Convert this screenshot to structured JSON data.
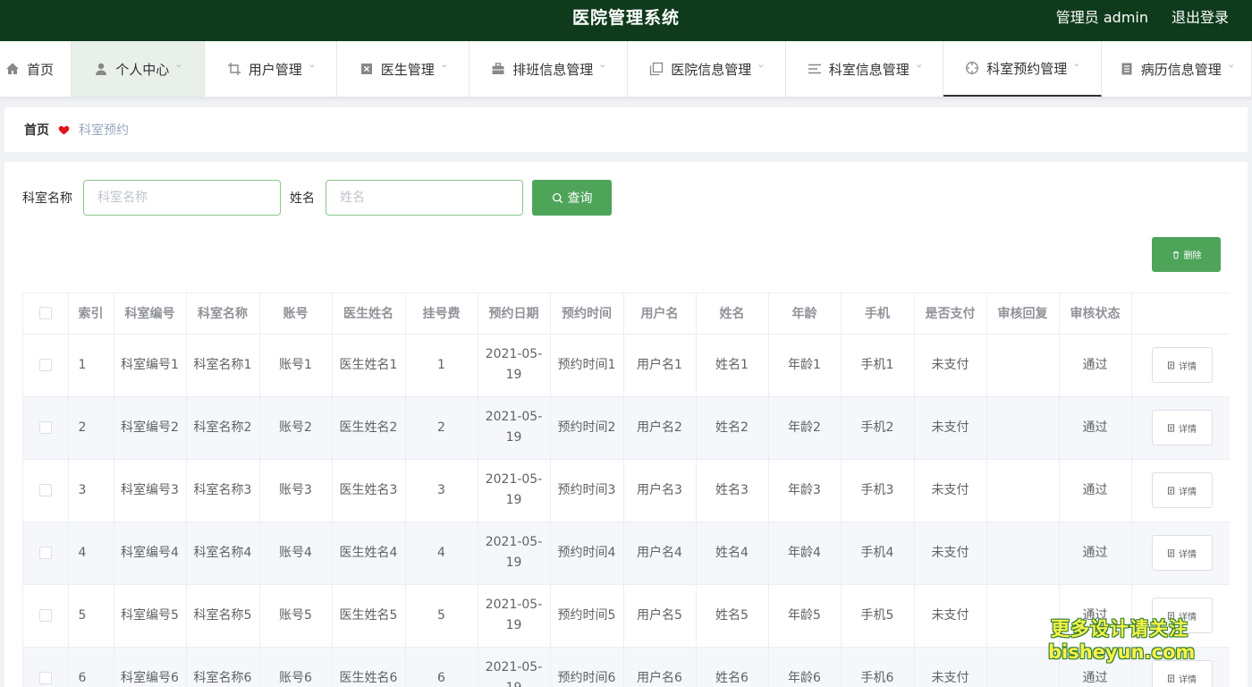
{
  "header": {
    "title": "医院管理系统",
    "user_label": "管理员 admin",
    "logout_label": "退出登录"
  },
  "nav": [
    {
      "key": "home",
      "label": "首页",
      "icon": "home-icon",
      "dropdown": false,
      "highlighted": false,
      "active": false
    },
    {
      "key": "personal-center",
      "label": "个人中心",
      "icon": "user-icon",
      "dropdown": true,
      "highlighted": true,
      "active": false
    },
    {
      "key": "user-management",
      "label": "用户管理",
      "icon": "crop-icon",
      "dropdown": true,
      "highlighted": false,
      "active": false
    },
    {
      "key": "doctor-management",
      "label": "医生管理",
      "icon": "close-box-icon",
      "dropdown": true,
      "highlighted": false,
      "active": false
    },
    {
      "key": "schedule-management",
      "label": "排班信息管理",
      "icon": "briefcase-icon",
      "dropdown": true,
      "highlighted": false,
      "active": false
    },
    {
      "key": "hospital-info-management",
      "label": "医院信息管理",
      "icon": "copy-icon",
      "dropdown": true,
      "highlighted": false,
      "active": false
    },
    {
      "key": "department-info-management",
      "label": "科室信息管理",
      "icon": "list-icon",
      "dropdown": true,
      "highlighted": false,
      "active": false
    },
    {
      "key": "department-appointment-management",
      "label": "科室预约管理",
      "icon": "crosshair-icon",
      "dropdown": true,
      "highlighted": false,
      "active": true
    },
    {
      "key": "medical-record-management",
      "label": "病历信息管理",
      "icon": "document-icon",
      "dropdown": true,
      "highlighted": false,
      "active": false
    }
  ],
  "breadcrumb": {
    "home": "首页",
    "current": "科室预约"
  },
  "search": {
    "dept_label": "科室名称",
    "dept_placeholder": "科室名称",
    "dept_value": "",
    "name_label": "姓名",
    "name_placeholder": "姓名",
    "name_value": "",
    "button_label": "查询"
  },
  "toolbar": {
    "delete_label": "删除"
  },
  "table": {
    "columns": [
      "索引",
      "科室编号",
      "科室名称",
      "账号",
      "医生姓名",
      "挂号费",
      "预约日期",
      "预约时间",
      "用户名",
      "姓名",
      "年龄",
      "手机",
      "是否支付",
      "审核回复",
      "审核状态"
    ],
    "detail_label": "详情",
    "rows": [
      {
        "index": "1",
        "dept_no": "科室编号1",
        "dept_name": "科室名称1",
        "account": "账号1",
        "doctor": "医生姓名1",
        "fee": "1",
        "date": "2021-05-19",
        "time": "预约时间1",
        "username": "用户名1",
        "name": "姓名1",
        "age": "年龄1",
        "phone": "手机1",
        "paid": "未支付",
        "reply": "",
        "status": "通过"
      },
      {
        "index": "2",
        "dept_no": "科室编号2",
        "dept_name": "科室名称2",
        "account": "账号2",
        "doctor": "医生姓名2",
        "fee": "2",
        "date": "2021-05-19",
        "time": "预约时间2",
        "username": "用户名2",
        "name": "姓名2",
        "age": "年龄2",
        "phone": "手机2",
        "paid": "未支付",
        "reply": "",
        "status": "通过"
      },
      {
        "index": "3",
        "dept_no": "科室编号3",
        "dept_name": "科室名称3",
        "account": "账号3",
        "doctor": "医生姓名3",
        "fee": "3",
        "date": "2021-05-19",
        "time": "预约时间3",
        "username": "用户名3",
        "name": "姓名3",
        "age": "年龄3",
        "phone": "手机3",
        "paid": "未支付",
        "reply": "",
        "status": "通过"
      },
      {
        "index": "4",
        "dept_no": "科室编号4",
        "dept_name": "科室名称4",
        "account": "账号4",
        "doctor": "医生姓名4",
        "fee": "4",
        "date": "2021-05-19",
        "time": "预约时间4",
        "username": "用户名4",
        "name": "姓名4",
        "age": "年龄4",
        "phone": "手机4",
        "paid": "未支付",
        "reply": "",
        "status": "通过"
      },
      {
        "index": "5",
        "dept_no": "科室编号5",
        "dept_name": "科室名称5",
        "account": "账号5",
        "doctor": "医生姓名5",
        "fee": "5",
        "date": "2021-05-19",
        "time": "预约时间5",
        "username": "用户名5",
        "name": "姓名5",
        "age": "年龄5",
        "phone": "手机5",
        "paid": "未支付",
        "reply": "",
        "status": "通过"
      },
      {
        "index": "6",
        "dept_no": "科室编号6",
        "dept_name": "科室名称6",
        "account": "账号6",
        "doctor": "医生姓名6",
        "fee": "6",
        "date": "2021-05-19",
        "time": "预约时间6",
        "username": "用户名6",
        "name": "姓名6",
        "age": "年龄6",
        "phone": "手机6",
        "paid": "未支付",
        "reply": "",
        "status": "通过"
      }
    ]
  },
  "watermark": {
    "line1": "更多设计请关注",
    "line2": "bisheyun.com"
  },
  "colors": {
    "header_bg": "#0f3b1c",
    "accent_green": "#4ea55a",
    "heart_red": "#e0141e",
    "watermark_yellow": "#f8f24a"
  }
}
